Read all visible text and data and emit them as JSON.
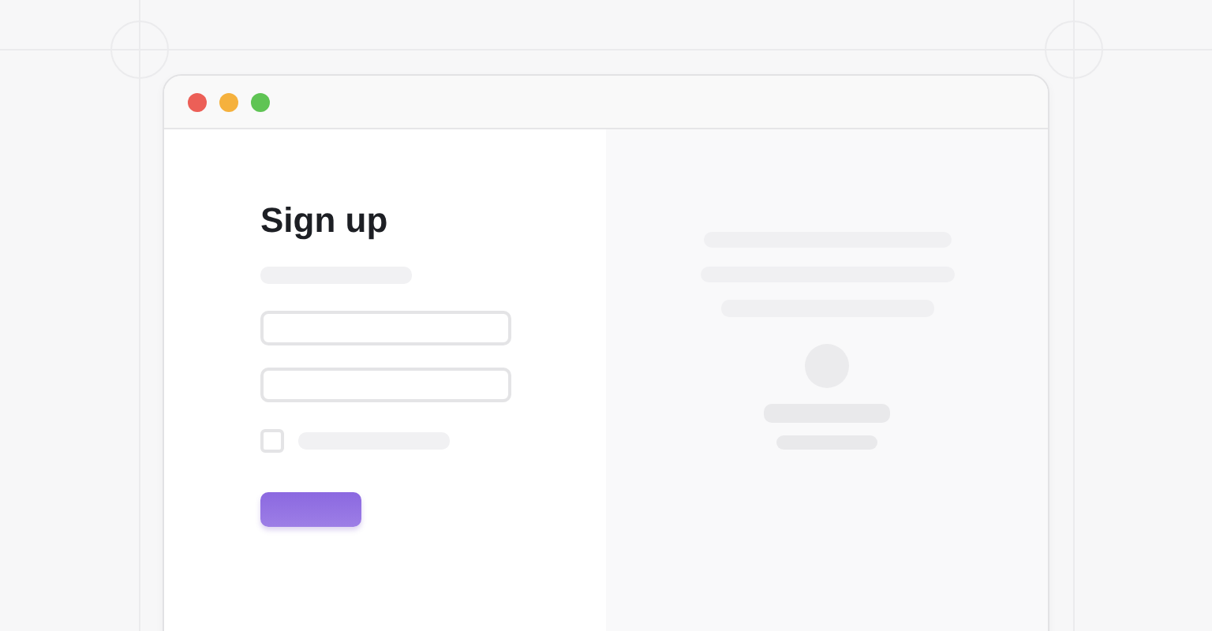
{
  "window_controls": [
    {
      "color": "#ec5f57"
    },
    {
      "color": "#f5b13d"
    },
    {
      "color": "#5fc454"
    }
  ],
  "form": {
    "title": "Sign up",
    "remember": {
      "checked": false
    }
  }
}
